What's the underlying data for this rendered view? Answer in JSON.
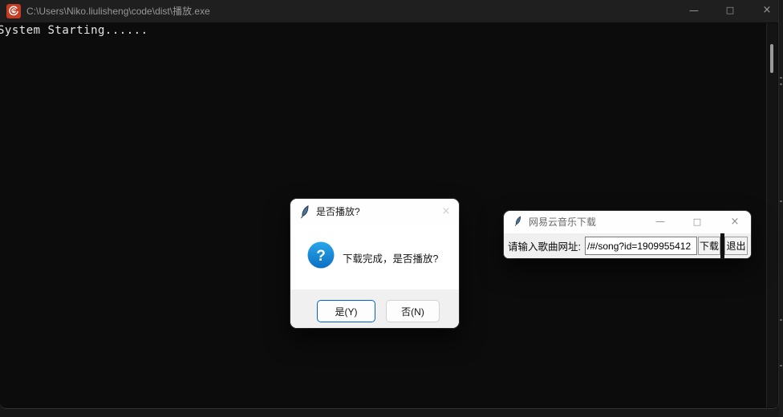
{
  "chrome": {
    "minimize": "—",
    "maximize": "□",
    "close": "×"
  },
  "console": {
    "title": "C:\\Users\\Niko.liulisheng\\code\\dist\\播放.exe",
    "output_text": "System Starting......"
  },
  "play_dialog": {
    "title": "是否播放?",
    "question_mark": "?",
    "message": "下载完成，是否播放?",
    "yes_label": "是(Y)",
    "no_label": "否(N)"
  },
  "download_window": {
    "title": "网易云音乐下载",
    "url_label": "请输入歌曲网址:",
    "url_value": "/#/song?id=1909955412",
    "download_label": "下载",
    "exit_label": "退出"
  },
  "icons": {
    "console_app_icon": "red-spiral-icon",
    "dialog_icon": "tk-feather-icon",
    "message_icon": "question-icon"
  },
  "colors": {
    "console_titlebar_bg": "#1f1f1f",
    "console_bg": "#0c0c0c",
    "console_title_fg": "#979797",
    "console_text_fg": "#e6e6e6",
    "accent_blue": "#0067c0",
    "question_icon_blue": "#1286d5",
    "app_icon_red": "#c63b22",
    "window_body_gray": "#f0f0f0"
  }
}
